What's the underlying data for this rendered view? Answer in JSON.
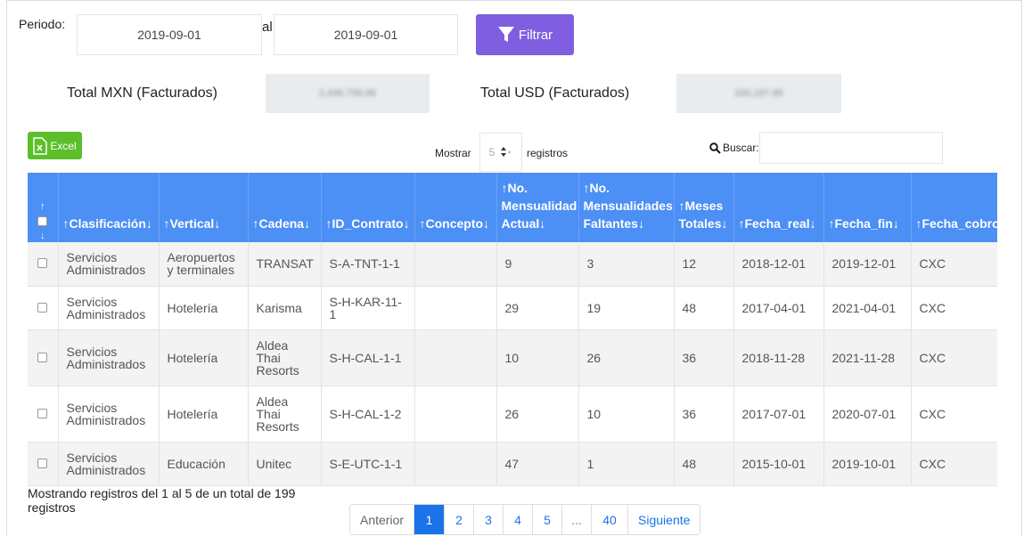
{
  "filter": {
    "periodo_label": "Periodo:",
    "date_from": "2019-09-01",
    "al_label": "al",
    "date_to": "2019-09-01",
    "button_label": "Filtrar",
    "button_color": "#7f5fe0"
  },
  "totals": {
    "mxn_label": "Total MXN (Facturados)",
    "mxn_value": "2,436,799.86",
    "usd_label": "Total USD (Facturados)",
    "usd_value": "330,197.85"
  },
  "toolbar": {
    "excel_label": "Excel",
    "excel_color": "#5cbf2a",
    "mostrar_label": "Mostrar",
    "page_size": "5",
    "registros_label": "registros",
    "buscar_label": "Buscar:",
    "search_value": ""
  },
  "table": {
    "header_color": "#4c8ff5",
    "columns": [
      {
        "line1": "",
        "line2": "",
        "line3": "Clasificación"
      },
      {
        "line1": "",
        "line2": "",
        "line3": "Vertical"
      },
      {
        "line1": "",
        "line2": "",
        "line3": "Cadena"
      },
      {
        "line1": "",
        "line2": "",
        "line3": "ID_Contrato"
      },
      {
        "line1": "",
        "line2": "",
        "line3": "Concepto"
      },
      {
        "line1": "No.",
        "line2": "Mensualidad",
        "line3": "Actual"
      },
      {
        "line1": "No.",
        "line2": "Mensualidades",
        "line3": "Faltantes"
      },
      {
        "line1": "",
        "line2": "Meses",
        "line3": "Totales"
      },
      {
        "line1": "",
        "line2": "",
        "line3": "Fecha_real"
      },
      {
        "line1": "",
        "line2": "",
        "line3": "Fecha_fin"
      },
      {
        "line1": "",
        "line2": "",
        "line3": "Fecha_cobro"
      }
    ],
    "rows": [
      {
        "clasificacion": "Servicios Administrados",
        "vertical": "Aeropuertos y terminales",
        "cadena": "TRANSAT",
        "id_contrato": "S-A-TNT-1-1",
        "concepto": "",
        "mensualidad_actual": "9",
        "mensualidades_faltantes": "3",
        "meses_totales": "12",
        "fecha_real": "2018-12-01",
        "fecha_fin": "2019-12-01",
        "fecha_cobro": "CXC"
      },
      {
        "clasificacion": "Servicios Administrados",
        "vertical": "Hotelería",
        "cadena": "Karisma",
        "id_contrato": "S-H-KAR-11-1",
        "concepto": "",
        "mensualidad_actual": "29",
        "mensualidades_faltantes": "19",
        "meses_totales": "48",
        "fecha_real": "2017-04-01",
        "fecha_fin": "2021-04-01",
        "fecha_cobro": "CXC"
      },
      {
        "clasificacion": "Servicios Administrados",
        "vertical": "Hotelería",
        "cadena": "Aldea Thai Resorts",
        "id_contrato": "S-H-CAL-1-1",
        "concepto": "",
        "mensualidad_actual": "10",
        "mensualidades_faltantes": "26",
        "meses_totales": "36",
        "fecha_real": "2018-11-28",
        "fecha_fin": "2021-11-28",
        "fecha_cobro": "CXC"
      },
      {
        "clasificacion": "Servicios Administrados",
        "vertical": "Hotelería",
        "cadena": "Aldea Thai Resorts",
        "id_contrato": "S-H-CAL-1-2",
        "concepto": "",
        "mensualidad_actual": "26",
        "mensualidades_faltantes": "10",
        "meses_totales": "36",
        "fecha_real": "2017-07-01",
        "fecha_fin": "2020-07-01",
        "fecha_cobro": "CXC"
      },
      {
        "clasificacion": "Servicios Administrados",
        "vertical": "Educación",
        "cadena": "Unitec",
        "id_contrato": "S-E-UTC-1-1",
        "concepto": "",
        "mensualidad_actual": "47",
        "mensualidades_faltantes": "1",
        "meses_totales": "48",
        "fecha_real": "2015-10-01",
        "fecha_fin": "2019-10-01",
        "fecha_cobro": "CXC"
      }
    ]
  },
  "footer": {
    "info": "Mostrando registros del 1 al 5 de un total de 199 registros"
  },
  "pagination": {
    "prev_label": "Anterior",
    "pages": [
      "1",
      "2",
      "3",
      "4",
      "5",
      "...",
      "40"
    ],
    "next_label": "Siguiente",
    "active_page": "1",
    "active_color": "#1a73e8"
  }
}
